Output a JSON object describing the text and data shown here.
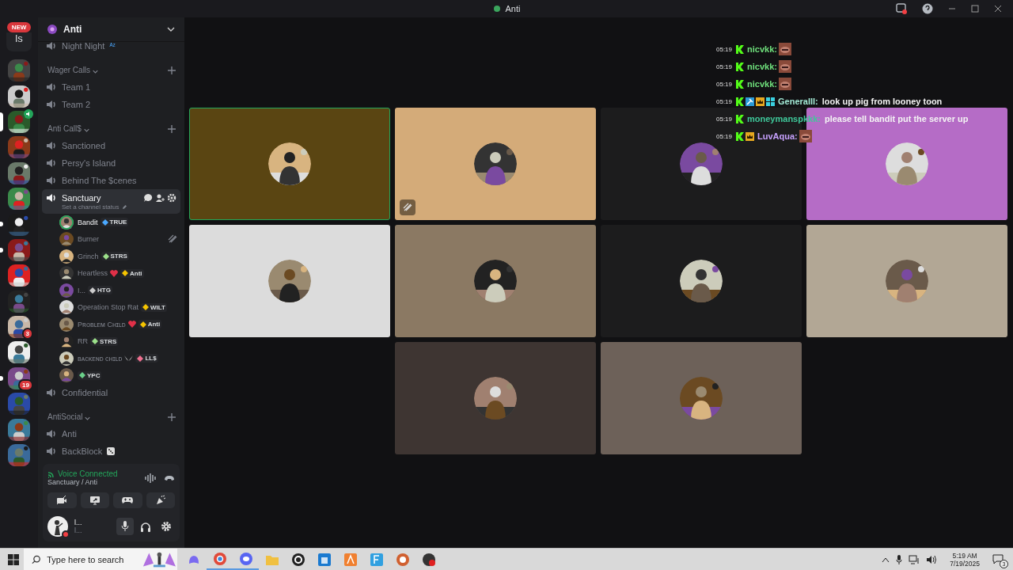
{
  "titlebar": {
    "title": "Anti"
  },
  "servers": {
    "new_badge": "NEW",
    "home_label": "ls",
    "items": [
      {
        "selected": false,
        "unread": false,
        "in_voice": false
      },
      {
        "selected": false,
        "unread": false,
        "in_voice": false
      },
      {
        "selected": true,
        "unread": false,
        "in_voice": true
      },
      {
        "selected": false,
        "unread": false,
        "in_voice": false
      },
      {
        "selected": false,
        "unread": false,
        "in_voice": false
      },
      {
        "selected": false,
        "unread": false,
        "in_voice": false
      },
      {
        "selected": false,
        "unread": true,
        "in_voice": false
      },
      {
        "selected": false,
        "unread": true,
        "in_voice": false
      },
      {
        "selected": false,
        "unread": false,
        "in_voice": false
      },
      {
        "selected": false,
        "unread": false,
        "in_voice": false
      },
      {
        "selected": false,
        "unread": false,
        "in_voice": false,
        "badge": "3"
      },
      {
        "selected": false,
        "unread": false,
        "in_voice": false
      },
      {
        "selected": false,
        "unread": true,
        "in_voice": false,
        "badge": "19"
      },
      {
        "selected": false,
        "unread": false,
        "in_voice": false
      },
      {
        "selected": false,
        "unread": false,
        "in_voice": false
      },
      {
        "selected": false,
        "unread": false,
        "in_voice": false
      }
    ]
  },
  "guild": {
    "name": "Anti",
    "expanded": true
  },
  "channels": [
    {
      "kind": "channel",
      "name": "Night Night",
      "tag": "ᴬᶻ",
      "selected": false
    },
    {
      "kind": "category",
      "name": "Wager Calls"
    },
    {
      "kind": "channel",
      "name": "Team 1",
      "selected": false
    },
    {
      "kind": "channel",
      "name": "Team 2",
      "selected": false
    },
    {
      "kind": "category",
      "name": "Anti Call$"
    },
    {
      "kind": "channel",
      "name": "Sanctioned",
      "selected": false
    },
    {
      "kind": "channel",
      "name": "Persy's Island",
      "selected": false
    },
    {
      "kind": "channel",
      "name": "Behind The $cenes",
      "selected": false
    },
    {
      "kind": "channel",
      "name": "Sanctuary",
      "selected": true,
      "status": "Set a channel status"
    },
    {
      "kind": "member",
      "name": "Bandit",
      "speaking": true,
      "heart": false,
      "emote": false,
      "muted": false,
      "tag": "TRUE",
      "color": "#4aa8ff"
    },
    {
      "kind": "member",
      "name": "Burner",
      "speaking": false,
      "heart": false,
      "emote": false,
      "muted": true
    },
    {
      "kind": "member",
      "name": "Grinch",
      "speaking": false,
      "heart": false,
      "emote": false,
      "muted": false,
      "tag": "STRS",
      "color": "#9be08a"
    },
    {
      "kind": "member",
      "name": "Heartless",
      "speaking": false,
      "heart": true,
      "emote": false,
      "muted": false,
      "tag": "Anti",
      "color": "#f5c400"
    },
    {
      "kind": "member",
      "name": "I...",
      "speaking": false,
      "heart": false,
      "emote": false,
      "muted": false,
      "tag": "HTG",
      "color": "#cccccc"
    },
    {
      "kind": "member",
      "name": "Operation Stop Rat",
      "speaking": false,
      "heart": false,
      "emote": false,
      "muted": false,
      "tag": "WILT",
      "color": "#f5c400"
    },
    {
      "kind": "member",
      "name": "Pʀᴏʙʟᴇᴍ Cʜɪʟᴅ",
      "speaking": false,
      "heart": true,
      "emote": false,
      "muted": false,
      "tag": "Anti",
      "color": "#f5c400"
    },
    {
      "kind": "member",
      "name": "RR",
      "speaking": false,
      "heart": false,
      "emote": false,
      "muted": false,
      "tag": "STRS",
      "color": "#9be08a"
    },
    {
      "kind": "member",
      "name": "ʙᴀᴄᴋᴇɴᴅ ᴄʜɪʟᴅ",
      "speaking": false,
      "heart": false,
      "emote": true,
      "muted": false,
      "tag": "LL$",
      "color": "#f07090"
    },
    {
      "kind": "member",
      "speaking": false,
      "heart": false,
      "emote": false,
      "muted": false,
      "tag": "YPC",
      "color": "#6ad08a"
    },
    {
      "kind": "channel",
      "name": "Confidential",
      "selected": false
    },
    {
      "kind": "category",
      "name": "AntiSocial"
    },
    {
      "kind": "channel",
      "name": "Anti",
      "selected": false
    },
    {
      "kind": "channel",
      "name": "BackBlock",
      "selected": false,
      "dice": true
    }
  ],
  "voice": {
    "status": "Voice Connected",
    "channel": "Sanctuary / Anti"
  },
  "user": {
    "name": "l...",
    "status": "l...",
    "dnd": true
  },
  "chat": [
    {
      "time": "05:19",
      "name": "nicvkk:",
      "color": "#6fe07c",
      "hammer": false,
      "crown": false,
      "grid": false,
      "emote": true
    },
    {
      "time": "05:19",
      "name": "nicvkk:",
      "color": "#6fe07c",
      "hammer": false,
      "crown": false,
      "grid": false,
      "emote": true
    },
    {
      "time": "05:19",
      "name": "nicvkk:",
      "color": "#6fe07c",
      "hammer": false,
      "crown": false,
      "grid": false,
      "emote": true
    },
    {
      "time": "05:19",
      "name": "Generalll:",
      "color": "#a3ead6",
      "hammer": true,
      "crown": true,
      "grid": true,
      "emote": false,
      "text": "look up pig from looney toon"
    },
    {
      "time": "05:19",
      "name": "moneymanspkkk:",
      "color": "#3fc89a",
      "hammer": false,
      "crown": false,
      "grid": false,
      "emote": false,
      "text": "please tell bandit put the server up"
    },
    {
      "time": "05:19",
      "name": "LuvAqua:",
      "color": "#c8a2ff",
      "hammer": false,
      "crown": true,
      "grid": false,
      "emote": true
    }
  ],
  "tiles": [
    {
      "color": "#5a4512",
      "speaking": true,
      "muted": false
    },
    {
      "color": "#d4ab79",
      "speaking": false,
      "muted": true
    },
    {
      "color": "#1c1c1d",
      "speaking": false,
      "muted": false
    },
    {
      "color": "#b56cc6",
      "speaking": false,
      "muted": false
    },
    {
      "color": "#dcdcdc",
      "speaking": false,
      "muted": false
    },
    {
      "color": "#8b7963",
      "speaking": false,
      "muted": false
    },
    {
      "color": "#1c1c1d",
      "speaking": false,
      "muted": false
    },
    {
      "color": "#b2a795",
      "speaking": false,
      "muted": false
    },
    {
      "color": "#3e3532",
      "speaking": false,
      "muted": false
    },
    {
      "color": "#6d6159",
      "speaking": false,
      "muted": false
    }
  ],
  "taskbar": {
    "search_placeholder": "Type here to search",
    "apps": [
      {
        "kind": "copilot",
        "active": false
      },
      {
        "kind": "browser",
        "active": true
      },
      {
        "kind": "chat",
        "active": true
      },
      {
        "kind": "folder",
        "active": false
      },
      {
        "kind": "circle",
        "active": false
      },
      {
        "kind": "store",
        "active": false
      },
      {
        "kind": "orange",
        "active": false
      },
      {
        "kind": "blue",
        "active": false
      },
      {
        "kind": "ring",
        "active": false
      },
      {
        "kind": "record",
        "active": false
      }
    ],
    "time": "5:19 AM",
    "date": "7/19/2025",
    "notifications": "3"
  }
}
